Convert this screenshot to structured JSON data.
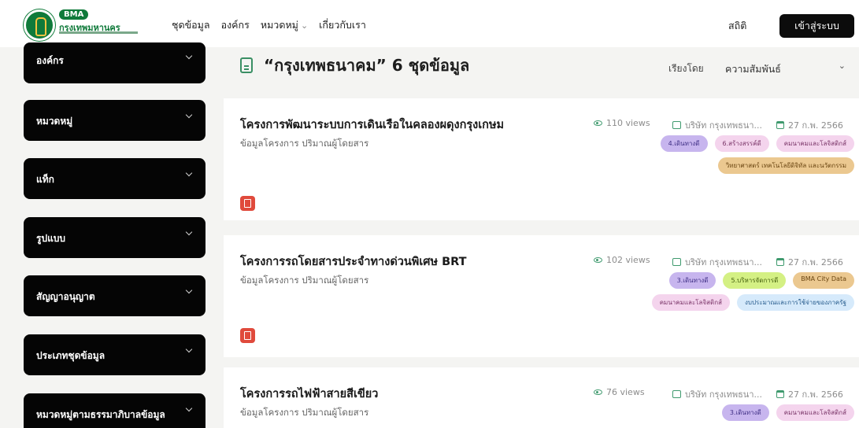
{
  "header": {
    "logo_badge": "BMA",
    "logo_name": "กรุงเทพมหานคร",
    "nav": [
      {
        "label": "ชุดข้อมูล"
      },
      {
        "label": "องค์กร"
      },
      {
        "label": "หมวดหมู่",
        "chevron": "chevron-down-icon"
      },
      {
        "label": "เกี่ยวกับเรา"
      }
    ],
    "stat_label": "สถิติ",
    "login_label": "เข้าสู่ระบบ"
  },
  "filters": [
    {
      "label": "องค์กร"
    },
    {
      "label": "หมวดหมู่"
    },
    {
      "label": "แท็ก"
    },
    {
      "label": "รูปแบบ"
    },
    {
      "label": "สัญญาอนุญาต"
    },
    {
      "label": "ประเภทชุดข้อมูล"
    },
    {
      "label": "หมวดหมู่ตามธรรมาภิบาลข้อมูล"
    }
  ],
  "results": {
    "title": "“กรุงเทพธนาคม” 6 ชุดข้อมูล",
    "sort_label": "เรียงโดย",
    "sort_value": "ความสัมพันธ์"
  },
  "datasets": [
    {
      "title": "โครงการพัฒนาระบบการเดินเรือในคลองผดุงกรุงเกษม",
      "subtitle": "ข้อมูลโครงการ ปริมาณผู้โดยสาร",
      "views": "110 views",
      "org": "บริษัท กรุงเทพธนา...",
      "date": "27 ก.พ. 2566",
      "tags": [
        {
          "label": "4.เดินทางดี",
          "color": "purple"
        },
        {
          "label": "6.สร้างสรรค์ดี",
          "color": "pink"
        },
        {
          "label": "คมนาคมและโลจิสติกส์",
          "color": "pink"
        },
        {
          "label": "วิทยาศาสตร์ เทคโนโลยีดิจิทัล และนวัตกรรม",
          "color": "orange"
        }
      ],
      "file_icon": "pdf-file-icon"
    },
    {
      "title": "โครงการรถโดยสารประจำทางด่วนพิเศษ BRT",
      "subtitle": "ข้อมูลโครงการ ปริมาณผู้โดยสาร",
      "views": "102 views",
      "org": "บริษัท กรุงเทพธนา...",
      "date": "27 ก.พ. 2566",
      "tags": [
        {
          "label": "3.เดินทางดี",
          "color": "purple"
        },
        {
          "label": "5.บริหารจัดการดี",
          "color": "green"
        },
        {
          "label": "BMA City Data",
          "color": "orange"
        },
        {
          "label": "คมนาคมและโลจิสติกส์",
          "color": "pink"
        },
        {
          "label": "งบประมาณและการใช้จ่ายของภาครัฐ",
          "color": "blue"
        }
      ],
      "file_icon": "pdf-file-icon"
    },
    {
      "title": "โครงการรถไฟฟ้าสายสีเขียว",
      "subtitle": "ข้อมูลโครงการ ปริมาณผู้โดยสาร",
      "views": "76 views",
      "org": "บริษัท กรุงเทพธนา...",
      "date": "27 ก.พ. 2566",
      "tags": [
        {
          "label": "3.เดินทางดี",
          "color": "purple"
        },
        {
          "label": "คมนาคมและโลจิสติกส์",
          "color": "pink"
        }
      ],
      "file_icon": "pdf-file-icon"
    }
  ],
  "colors": {
    "accent_green": "#0f7a3a",
    "button_black": "#0c0c0c",
    "pdf_red": "#e04a3c"
  }
}
